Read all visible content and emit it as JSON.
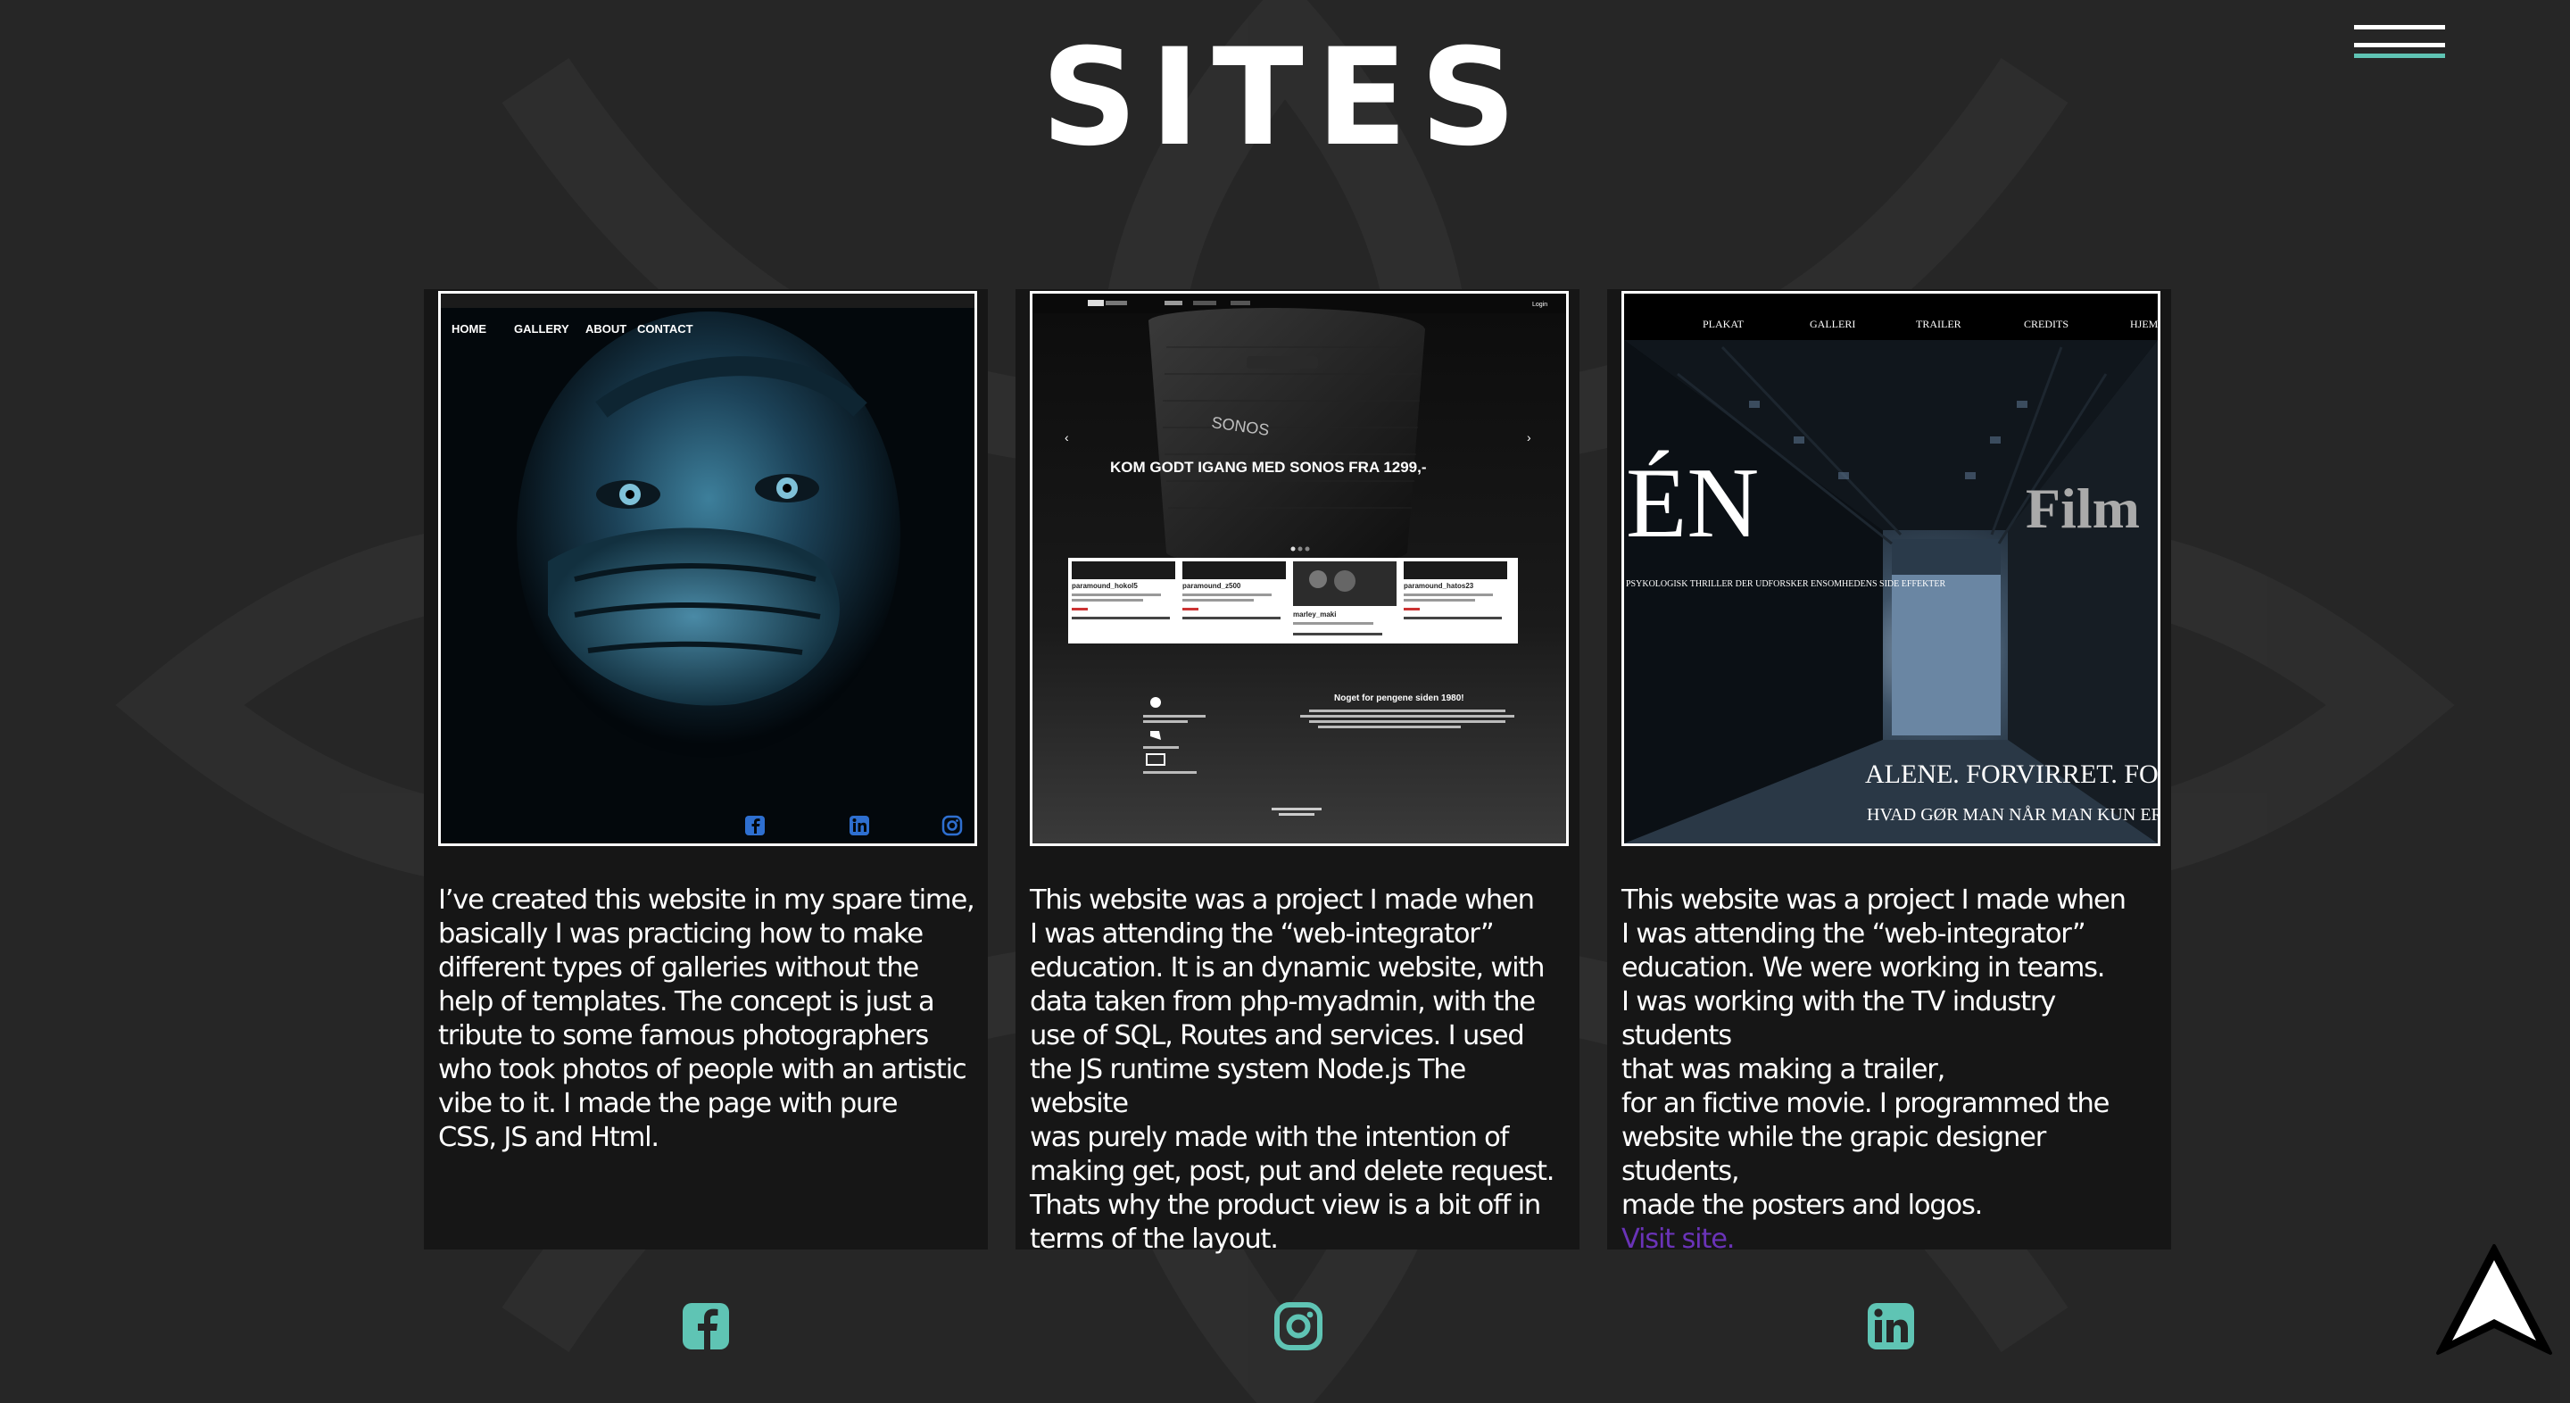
{
  "page": {
    "title": "SITES"
  },
  "colors": {
    "background": "#262626",
    "card": "#161616",
    "accent": "#5fc4b4",
    "link": "#6a33b8",
    "menu_line": "#ffffff"
  },
  "menu": {
    "icon": "hamburger-menu-icon"
  },
  "cards": [
    {
      "preview": {
        "nav": [
          "HOME",
          "GALLERY",
          "ABOUT",
          "CONTACT"
        ],
        "icons": [
          "facebook-icon",
          "linkedin-icon",
          "instagram-icon"
        ]
      },
      "text": "I’ve created this website in my spare time,\nbasically I was practicing how to make\ndifferent types of galleries without the\nhelp of templates. The concept is just a\ntribute to some famous photographers\nwho took photos of people with an artistic\nvibe to it. I made the page with pure\nCSS, JS and Html."
    },
    {
      "preview": {
        "headline": "KOM GODT IGANG MED SONOS FRA 1299,-",
        "brand": "SONOS",
        "products": [
          "paramound_hokol5",
          "paramound_z500",
          "marley_maki",
          "paramound_hatos23"
        ],
        "tagline": "Noget for pengene siden 1980!",
        "nav_login": "Login"
      },
      "text": "This website was a project I made when\nI was attending the “web-integrator”\neducation. It is an dynamic website, with\ndata taken from php-myadmin, with the\nuse of SQL, Routes and services. I used\nthe JS runtime system Node.js The website\nwas purely made with the intention of\nmaking get, post, put and delete request.\nThats why the product view is a bit off in\nterms of the layout."
    },
    {
      "preview": {
        "nav": [
          "PLAKAT",
          "GALLERI",
          "TRAILER",
          "CREDITS",
          "HJEM"
        ],
        "title": "ÉN",
        "logo": "Film",
        "subtitle": "PSYKOLOGISK THRILLER DER UDFORSKER ENSOMHEDENS SIDE EFFEKTER",
        "tagline": "ALENE. FORVIRRET. FORTABT.",
        "question": "HVAD GØR MAN NÅR MAN KUN ER ÉN?"
      },
      "text": "This website was a project I made when\nI was attending the “web-integrator”\neducation. We were working in teams.\nI was working with the TV industry\nstudents\nthat was making a trailer,\nfor an fictive movie. I programmed the\nwebsite while the grapic designer students,\nmade the posters and logos.",
      "link_text": "Visit site."
    }
  ],
  "social": [
    {
      "icon": "facebook-icon",
      "color": "#5fc4b4"
    },
    {
      "icon": "instagram-icon",
      "color": "#5fc4b4"
    },
    {
      "icon": "linkedin-icon",
      "color": "#5fc4b4"
    }
  ],
  "back_to_top": {
    "icon": "arrow-up-icon"
  }
}
